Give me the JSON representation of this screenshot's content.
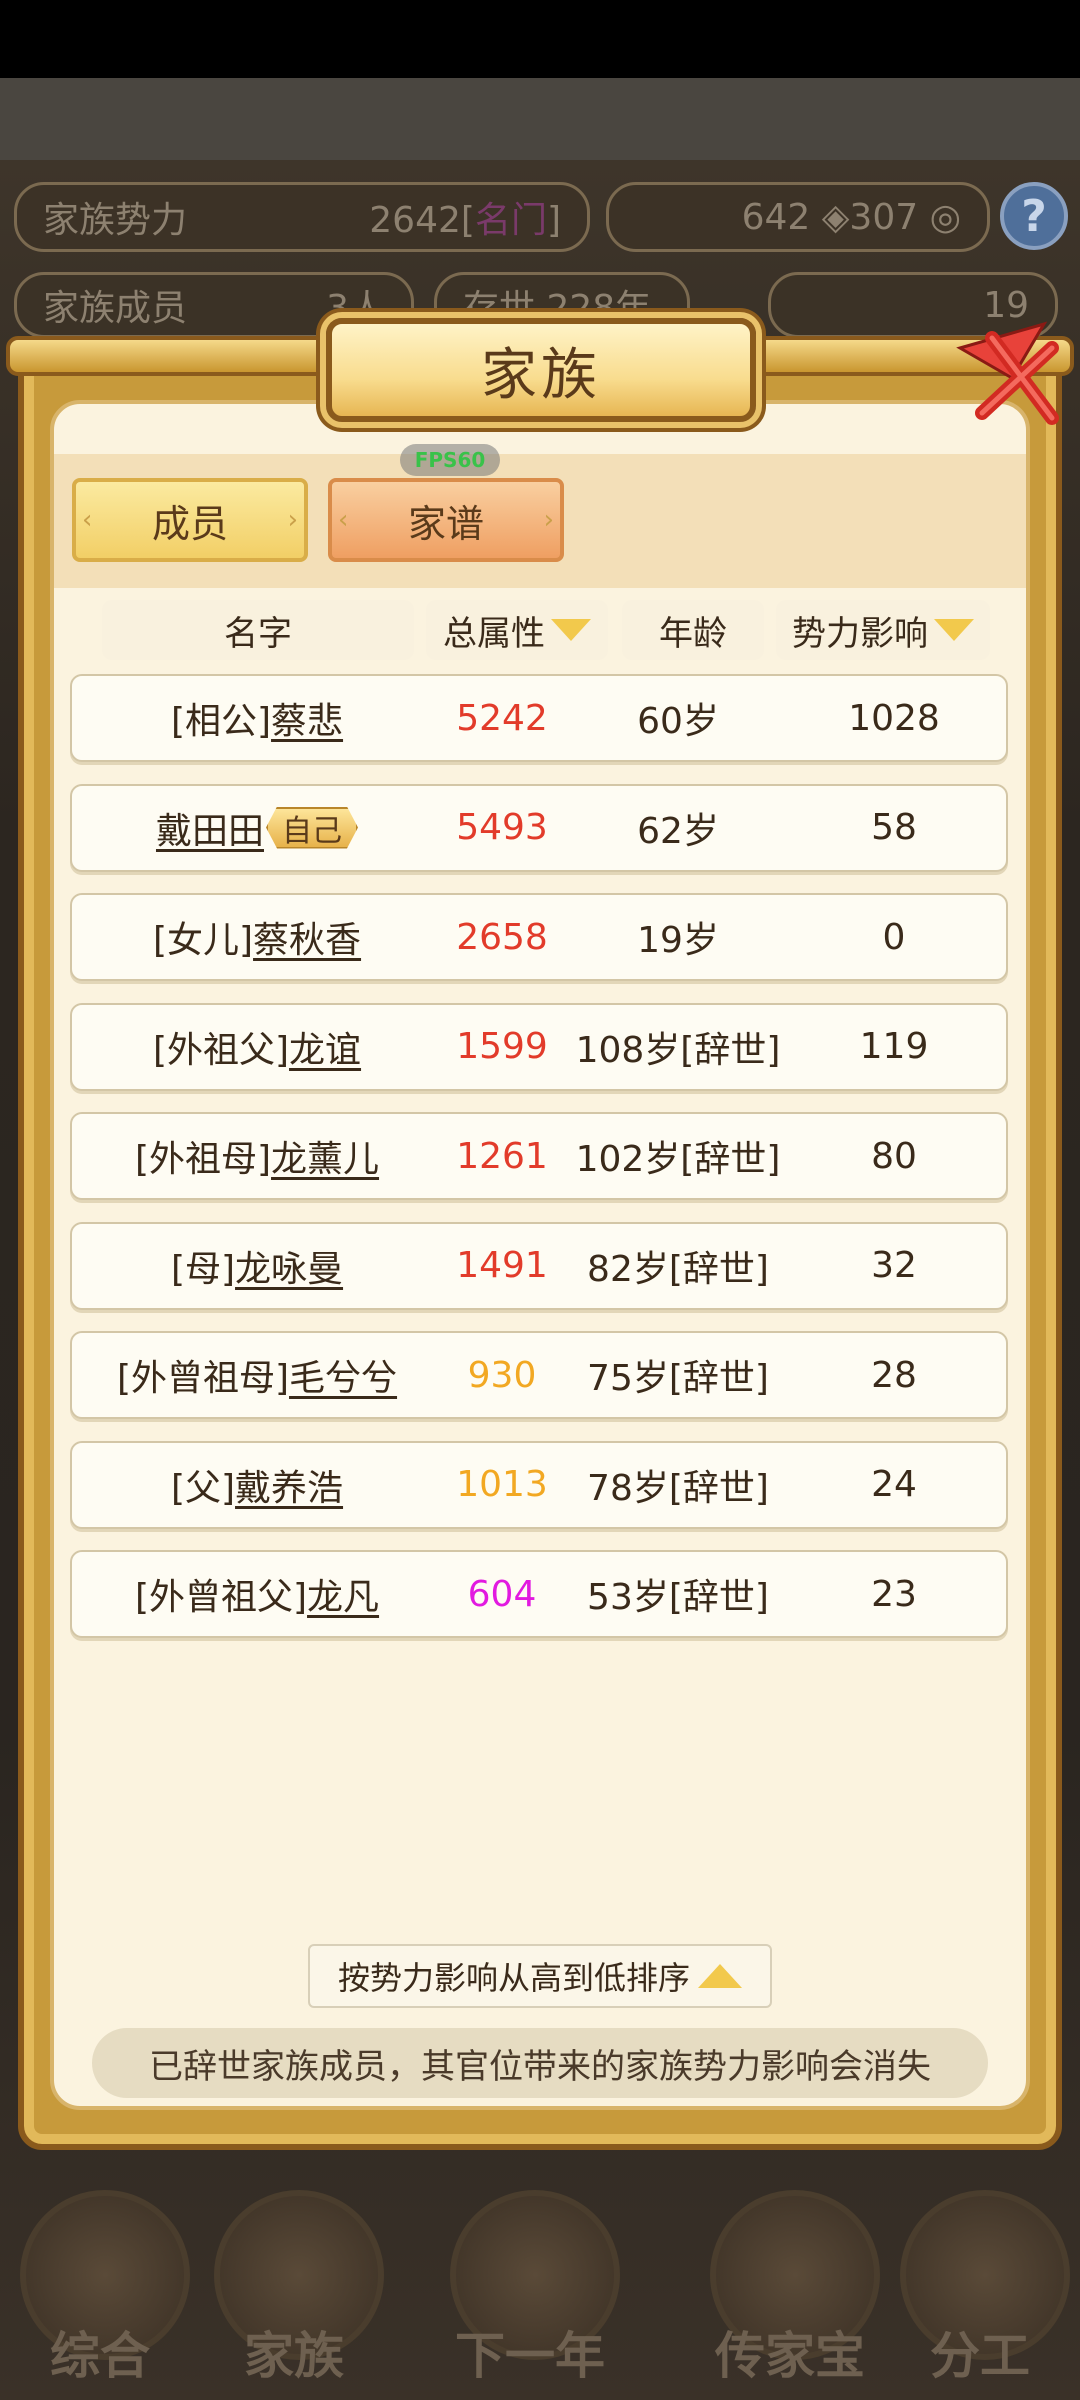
{
  "background": {
    "family_power_label": "家族势力",
    "family_power_value": "2642",
    "family_power_rank": "名门",
    "resource_a": "642",
    "resource_b": "307",
    "members_label": "家族成员",
    "members_value": "3人",
    "existence": "存世 228年",
    "gold": "19"
  },
  "dialog": {
    "title": "家族",
    "fps": "FPS60",
    "tabs": [
      {
        "label": "成员",
        "active": true
      },
      {
        "label": "家谱",
        "active": false
      }
    ],
    "columns": [
      "名字",
      "总属性",
      "年龄",
      "势力影响"
    ],
    "self_badge": "自己",
    "rows": [
      {
        "prefix": "[相公]",
        "name": "蔡悲",
        "total": "5242",
        "total_color": "#e23b2a",
        "age": "60岁",
        "influence": "1028"
      },
      {
        "prefix": "",
        "name": "戴田田",
        "self": true,
        "total": "5493",
        "total_color": "#e23b2a",
        "age": "62岁",
        "influence": "58"
      },
      {
        "prefix": "[女儿]",
        "name": "蔡秋香",
        "total": "2658",
        "total_color": "#e23b2a",
        "age": "19岁",
        "influence": "0"
      },
      {
        "prefix": "[外祖父]",
        "name": "龙谊",
        "total": "1599",
        "total_color": "#e23b2a",
        "age": "108岁[辞世]",
        "influence": "119"
      },
      {
        "prefix": "[外祖母]",
        "name": "龙薰儿",
        "total": "1261",
        "total_color": "#e23b2a",
        "age": "102岁[辞世]",
        "influence": "80"
      },
      {
        "prefix": "[母]",
        "name": "龙咏曼",
        "total": "1491",
        "total_color": "#e23b2a",
        "age": "82岁[辞世]",
        "influence": "32"
      },
      {
        "prefix": "[外曾祖母]",
        "name": "毛兮兮",
        "total": "930",
        "total_color": "#f2a822",
        "age": "75岁[辞世]",
        "influence": "28"
      },
      {
        "prefix": "[父]",
        "name": "戴养浩",
        "total": "1013",
        "total_color": "#f2a822",
        "age": "78岁[辞世]",
        "influence": "24"
      },
      {
        "prefix": "[外曾祖父]",
        "name": "龙凡",
        "total": "604",
        "total_color": "#e21ae0",
        "age": "53岁[辞世]",
        "influence": "23"
      }
    ],
    "sort_label": "按势力影响从高到低排序",
    "notice": "已辞世家族成员，其官位带来的家族势力影响会消失"
  },
  "bottom_nav": [
    "综合",
    "家族",
    "下一年",
    "传家宝",
    "分工"
  ]
}
